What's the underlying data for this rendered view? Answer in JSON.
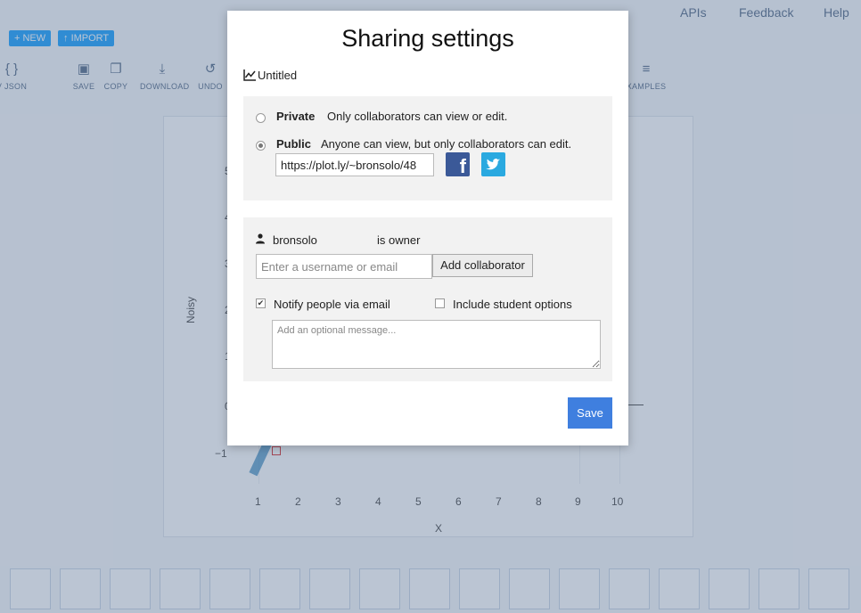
{
  "nav": {
    "apis": "APIs",
    "feedback": "Feedback",
    "help": "Help"
  },
  "toolbar": {
    "new_label": "NEW",
    "import_label": "IMPORT",
    "json_label": "V JSON",
    "save_label": "SAVE",
    "copy_label": "COPY",
    "download_label": "DOWNLOAD",
    "undo_label": "UNDO",
    "examples_label": "XAMPLES"
  },
  "plot": {
    "xlabel": "X",
    "ylabel": "Noisy",
    "xticks": [
      "1",
      "2",
      "3",
      "4",
      "5",
      "6",
      "7",
      "8",
      "9",
      "10"
    ],
    "yticks": [
      "5",
      "4",
      "3",
      "2",
      "1",
      "0",
      "−1"
    ]
  },
  "modal": {
    "title": "Sharing settings",
    "plot_name": "Untitled",
    "privacy": {
      "private_label": "Private",
      "private_desc": "Only collaborators can view or edit.",
      "public_label": "Public",
      "public_desc": "Anyone can view, but only collaborators can edit.",
      "selected": "public",
      "share_url": "https://plot.ly/~bronsolo/48"
    },
    "collaborators": {
      "owner_name": "bronsolo",
      "owner_role": "is owner",
      "username_placeholder": "Enter a username or email",
      "add_button": "Add collaborator",
      "notify_label": "Notify people via email",
      "notify_checked": true,
      "student_label": "Include student options",
      "student_checked": false,
      "message_placeholder": "Add an optional message..."
    },
    "save_label": "Save"
  },
  "colors": {
    "accent": "#3f7fdf",
    "facebook": "#3b5998",
    "twitter": "#2aa9e0"
  },
  "icons": [
    "line-chart-icon",
    "user-icon",
    "facebook-icon",
    "twitter-icon"
  ]
}
